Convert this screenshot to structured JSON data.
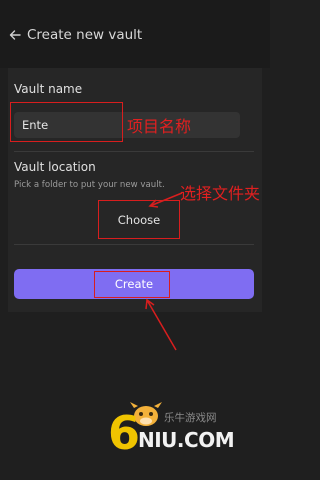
{
  "header": {
    "title": "Create new vault"
  },
  "vault_name": {
    "label": "Vault name",
    "value": "Ente"
  },
  "vault_location": {
    "label": "Vault location",
    "hint": "Pick a folder to put your new vault.",
    "choose_label": "Choose"
  },
  "create_label": "Create",
  "annotations": {
    "name_note": "项目名称",
    "folder_note": "选择文件夹"
  },
  "watermark": {
    "brand": "NIU.COM",
    "digit": "6",
    "cn": "乐牛游戏网"
  },
  "colors": {
    "background": "#1f1f1f",
    "panel": "#262626",
    "accent": "#7f6df2",
    "annotation": "#d81e1e"
  }
}
